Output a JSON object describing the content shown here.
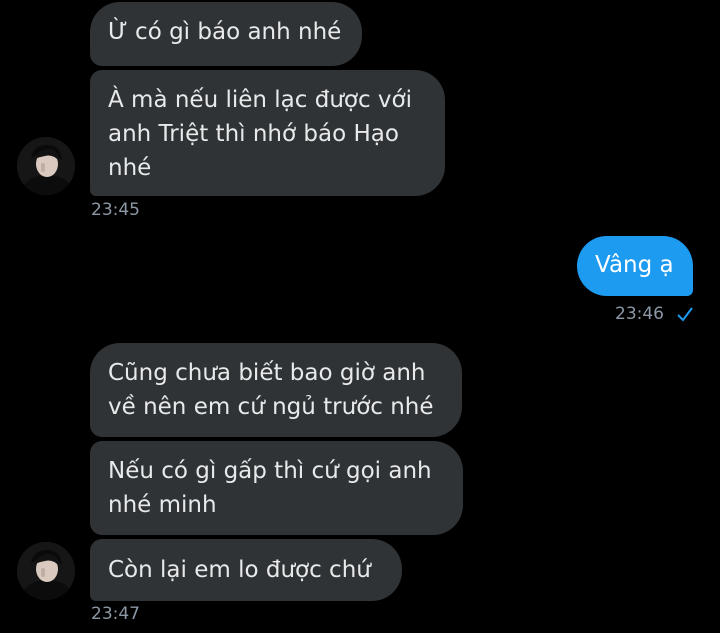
{
  "colors": {
    "background": "#000000",
    "incoming_bubble": "#2f3336",
    "outgoing_bubble": "#1d9bf0",
    "timestamp": "#8b98a5",
    "check": "#1d9bf0"
  },
  "messages": [
    {
      "direction": "incoming",
      "text": "Ừ có gì báo anh nhé"
    },
    {
      "direction": "incoming",
      "text": "À mà nếu liên lạc được với anh Triệt thì nhớ báo Hạo nhé"
    },
    {
      "direction": "outgoing",
      "text": "Vâng ạ"
    },
    {
      "direction": "incoming",
      "text": "Cũng chưa biết bao giờ anh về nên em cứ ngủ trước nhé"
    },
    {
      "direction": "incoming",
      "text": "Nếu có gì gấp thì cứ gọi anh nhé minh"
    },
    {
      "direction": "incoming",
      "text": "Còn lại em lo được chứ"
    }
  ],
  "timestamps": {
    "group1": "23:45",
    "outgoing": "23:46",
    "group2": "23:47"
  },
  "icons": {
    "avatar": "user-avatar",
    "read_receipt": "check-icon"
  }
}
